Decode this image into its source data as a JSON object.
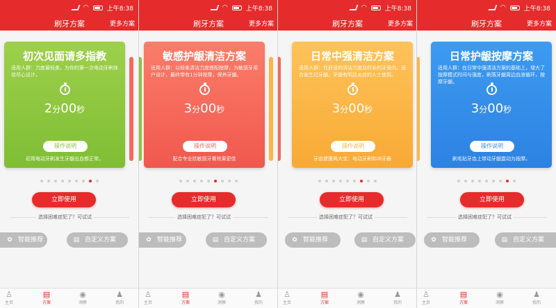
{
  "status": {
    "time": "上午8:38"
  },
  "nav": {
    "title": "刷牙方案",
    "more": "更多方案"
  },
  "dots_count": 9,
  "use_button": "立即使用",
  "hint": "选择困难症犯了？可试试",
  "pills": {
    "smart": "智能推荐",
    "custom": "自定义方案"
  },
  "tabs": {
    "home": "主页",
    "plan": "方案",
    "report": "洞察",
    "mine": "我的"
  },
  "panels": [
    {
      "card": {
        "title": "初次见面请多指教",
        "desc": "适用人群：力度最轻柔，为你的第一次电动牙刷体验尽心设计。",
        "minutes": "2",
        "seconds": "00",
        "min_unit": "分",
        "sec_unit": "秒",
        "button": "操作说明",
        "note": "初用电动牙刷发生牙龈出血都正常。"
      },
      "colors": {
        "card_top": "#9ed04b",
        "card_bottom": "#7fbe34",
        "accent": "#8bc53f"
      },
      "active_dot": 8
    },
    {
      "card": {
        "title": "敏感护龈清洁方案",
        "desc": "适用人群：以轻柔清洁力度搭配按摩，为敏感牙用户设计，最终带有1分钟按摩，保养牙龈。",
        "minutes": "3",
        "seconds": "00",
        "min_unit": "分",
        "sec_unit": "秒",
        "button": "操作说明",
        "note": "配合专业抗敏感牙膏效果更佳"
      },
      "colors": {
        "card_top": "#fb7d6a",
        "card_bottom": "#f0584e",
        "accent": "#f36a5c"
      },
      "active_dot": 6
    },
    {
      "card": {
        "title": "日常中强清洁方案",
        "desc": "适用人群：在舒适的清洁力度及时长的牙周内，适合发生过牙龈，牙龈有明显炎症的人士使用。",
        "minutes": "3",
        "seconds": "00",
        "min_unit": "分",
        "sec_unit": "秒",
        "button": "操作说明",
        "note": "牙齿健康两大宝：电动牙刷和冲牙器"
      },
      "colors": {
        "card_top": "#ffc35a",
        "card_bottom": "#f8a934",
        "accent": "#fbb646"
      },
      "active_dot": 7
    },
    {
      "card": {
        "title": "日常护龈按摩方案",
        "desc": "适用人群：在日常中强清洁方案的基础上，增大了按摩模式时间与强度，刷落牙龈周边血液循环，按摩牙龈。",
        "minutes": "3",
        "seconds": "00",
        "min_unit": "分",
        "sec_unit": "秒",
        "button": "操作说明",
        "note": "刷毛贴牙齿上带动牙龈震动为按摩。"
      },
      "colors": {
        "card_top": "#3d9bf0",
        "card_bottom": "#2d82e2",
        "accent": "#3790ea"
      },
      "active_dot": 8
    }
  ]
}
